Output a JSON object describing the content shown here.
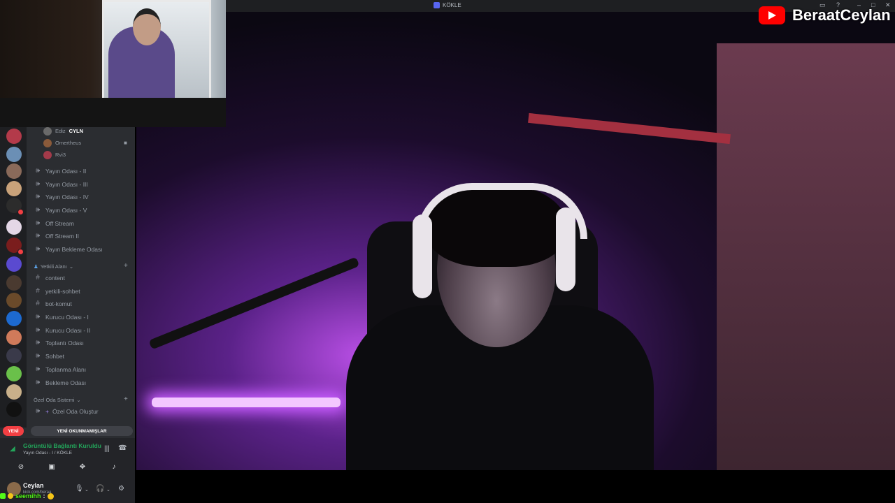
{
  "window": {
    "title": "KÖKLE"
  },
  "overlay": {
    "channel_name": "BeraatCeylan"
  },
  "sidebar": {
    "members": [
      "Ediz",
      "CYLN",
      "Omertheus",
      "Rvi3"
    ],
    "voice_channels": [
      "Yayın Odası - II",
      "Yayın Odası - III",
      "Yayın Odası - IV",
      "Yayın Odası - V",
      "Off Stream",
      "Off Stream II",
      "Yayın Bekleme Odası"
    ],
    "category_staff": "Yetkili Alanı",
    "staff_channels": [
      {
        "name": "content",
        "type": "text"
      },
      {
        "name": "yetkili-sohbet",
        "type": "text"
      },
      {
        "name": "bot-komut",
        "type": "text"
      },
      {
        "name": "Kurucu Odası - I",
        "type": "voice"
      },
      {
        "name": "Kurucu Odası - II",
        "type": "voice"
      },
      {
        "name": "Toplantı Odası",
        "type": "voice"
      },
      {
        "name": "Sohbet",
        "type": "voice"
      },
      {
        "name": "Toplanma Alanı",
        "type": "voice"
      },
      {
        "name": "Bekleme Odası",
        "type": "voice"
      }
    ],
    "category_private": "Özel Oda Sistemi",
    "private_channels": [
      "Özel Oda Oluştur"
    ],
    "new_badge": "YENİ",
    "unread_label": "YENİ OKUNMAMIŞLAR"
  },
  "voice": {
    "status": "Görüntülü Bağlantı Kuruldu",
    "location": "Yayın Odası - I / KÖKLE"
  },
  "user": {
    "name": "Ceylan",
    "status": "kick.com/beraa"
  },
  "chat": {
    "username": "seemihh",
    "separator": ":"
  },
  "colors": {
    "online": "#23a55a",
    "danger": "#f23f43",
    "youtube": "#ff0000",
    "kick": "#53fc18"
  }
}
